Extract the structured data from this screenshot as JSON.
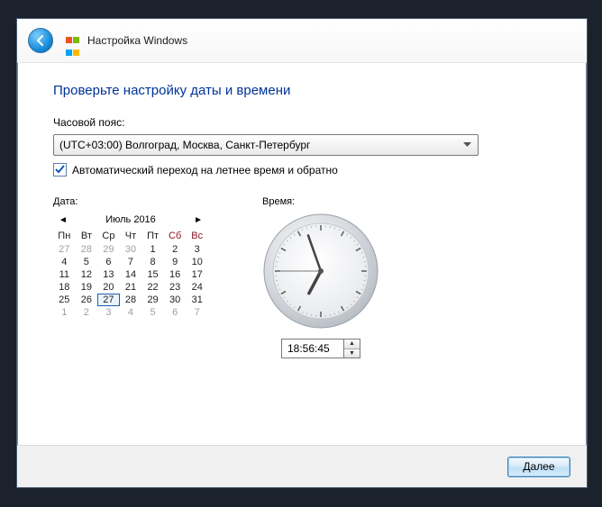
{
  "header": {
    "title": "Настройка Windows"
  },
  "heading": "Проверьте настройку даты и времени",
  "tz": {
    "label": "Часовой пояс:",
    "value": "(UTC+03:00) Волгоград, Москва, Санкт-Петербург"
  },
  "dst": {
    "label": "Автоматический переход на летнее время и обратно",
    "checked": true
  },
  "date_label": "Дата:",
  "time_label": "Время:",
  "calendar": {
    "title": "Июль 2016",
    "dow": [
      "Пн",
      "Вт",
      "Ср",
      "Чт",
      "Пт",
      "Сб",
      "Вс"
    ],
    "weeks": [
      [
        {
          "n": 27,
          "dim": true
        },
        {
          "n": 28,
          "dim": true
        },
        {
          "n": 29,
          "dim": true
        },
        {
          "n": 30,
          "dim": true
        },
        {
          "n": 1
        },
        {
          "n": 2
        },
        {
          "n": 3
        }
      ],
      [
        {
          "n": 4
        },
        {
          "n": 5
        },
        {
          "n": 6
        },
        {
          "n": 7
        },
        {
          "n": 8
        },
        {
          "n": 9
        },
        {
          "n": 10
        }
      ],
      [
        {
          "n": 11
        },
        {
          "n": 12
        },
        {
          "n": 13
        },
        {
          "n": 14
        },
        {
          "n": 15
        },
        {
          "n": 16
        },
        {
          "n": 17
        }
      ],
      [
        {
          "n": 18
        },
        {
          "n": 19
        },
        {
          "n": 20
        },
        {
          "n": 21
        },
        {
          "n": 22
        },
        {
          "n": 23
        },
        {
          "n": 24
        }
      ],
      [
        {
          "n": 25
        },
        {
          "n": 26
        },
        {
          "n": 27,
          "today": true
        },
        {
          "n": 28
        },
        {
          "n": 29
        },
        {
          "n": 30
        },
        {
          "n": 31
        }
      ],
      [
        {
          "n": 1,
          "dim": true
        },
        {
          "n": 2,
          "dim": true
        },
        {
          "n": 3,
          "dim": true
        },
        {
          "n": 4,
          "dim": true
        },
        {
          "n": 5,
          "dim": true
        },
        {
          "n": 6,
          "dim": true
        },
        {
          "n": 7,
          "dim": true
        }
      ]
    ]
  },
  "time": {
    "value": "18:56:45",
    "hour": 18,
    "minute": 56,
    "second": 45
  },
  "next": "Далее"
}
